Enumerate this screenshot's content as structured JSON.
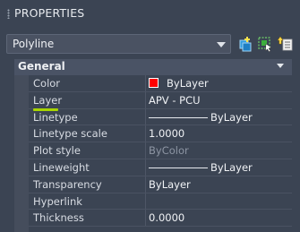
{
  "panel": {
    "title": "PROPERTIES"
  },
  "selector": {
    "value": "Polyline"
  },
  "toolbar": {
    "icons": [
      "toggle-pickadd-icon",
      "select-objects-icon",
      "quick-select-icon"
    ]
  },
  "section": {
    "title": "General"
  },
  "properties": [
    {
      "name": "Color",
      "value": "ByLayer",
      "swatch": "#ff0000"
    },
    {
      "name": "Layer",
      "value": "APV - PCU"
    },
    {
      "name": "Linetype",
      "value": "ByLayer"
    },
    {
      "name": "Linetype scale",
      "value": "1.0000"
    },
    {
      "name": "Plot style",
      "value": "ByColor"
    },
    {
      "name": "Lineweight",
      "value": "ByLayer"
    },
    {
      "name": "Transparency",
      "value": "ByLayer"
    },
    {
      "name": "Hyperlink",
      "value": ""
    },
    {
      "name": "Thickness",
      "value": "0.0000"
    }
  ],
  "colors": {
    "background": "#3b4453",
    "accent": "#a8d400",
    "color_swatch": "#ff0000"
  }
}
